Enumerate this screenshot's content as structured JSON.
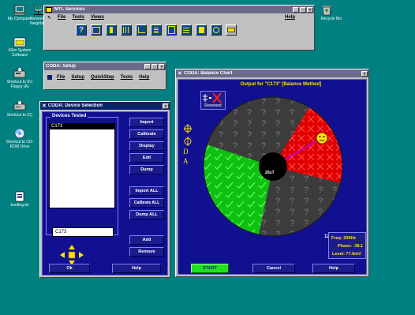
{
  "desktop": {
    "icons": [
      {
        "label": "My Computer",
        "icon": "computer-icon"
      },
      {
        "label": "Network Neighborhood",
        "icon": "network-icon"
      },
      {
        "label": "42ex System Software",
        "icon": "folder-icon"
      },
      {
        "label": "Shortcut to 3½ Floppy (A)",
        "icon": "floppy-icon"
      },
      {
        "label": "Shortcut to (C)",
        "icon": "drive-icon"
      },
      {
        "label": "Shortcut to CD-ROM Drive",
        "icon": "cdrom-icon"
      },
      {
        "label": "bootlog.txt",
        "icon": "file-icon"
      },
      {
        "label": "Recycle Bin",
        "icon": "recycle-bin-icon"
      }
    ]
  },
  "services": {
    "title": "MTL Services",
    "menu": [
      "File",
      "Tools",
      "Views"
    ],
    "help": "Help"
  },
  "setup": {
    "title": "CODA: Setup",
    "menu": [
      "File",
      "Setup",
      "QuickStep",
      "Tools",
      "Help"
    ]
  },
  "device": {
    "title": "CODA: Device Selection",
    "group_label": "Devices Tested",
    "list_items": [
      "C173"
    ],
    "field_value": "C173",
    "buttons": {
      "import": "Import",
      "calibrate": "Calibrate",
      "display": "Display",
      "edit": "Edit",
      "dump": "Dump",
      "import_all": "Import ALL",
      "calibrate_all": "Calibrate ALL",
      "dump_all": "Dump ALL",
      "add": "Add",
      "remove": "Remove",
      "ok": "Ok",
      "help": "Help"
    }
  },
  "balance": {
    "title": "CODA: Balance Chart",
    "output_title": "Output for \"C173\"  [Balance Method]",
    "reversed_label": "Reversed",
    "center_label": "20uT",
    "side_letters": [
      "D",
      "A"
    ],
    "clock_label": "12",
    "readout": {
      "freq": "Freq: 200Hz",
      "phase": "Phase: -38.1",
      "level": "Level: 77.6mV"
    },
    "buttons": {
      "start": "START",
      "cancel": "Cancel",
      "help": "Help"
    },
    "colors": {
      "red": "#e00000",
      "green": "#10c010",
      "disc": "#3c3c3c",
      "indicator": "#ffe000"
    }
  }
}
